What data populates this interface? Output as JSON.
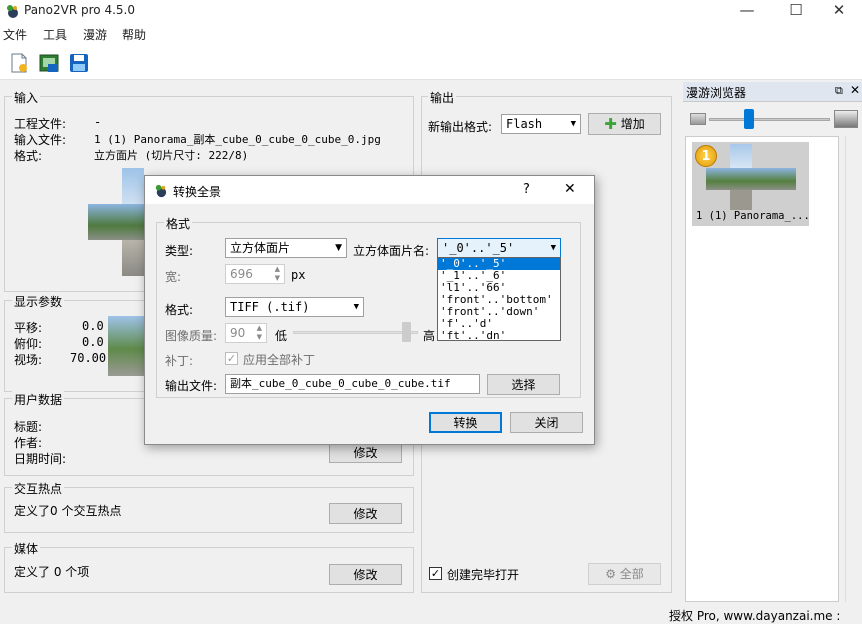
{
  "window": {
    "title": "Pano2VR pro 4.5.0",
    "minimize": "—",
    "maximize": "☐",
    "close": "✕"
  },
  "menu": [
    "文件",
    "工具",
    "漫游",
    "帮助"
  ],
  "input": {
    "title": "输入",
    "project_label": "工程文件:",
    "project_value": "-",
    "input_label": "输入文件:",
    "input_value": "1 (1) Panorama_副本_cube_0_cube_0_cube_0.jpg",
    "format_label": "格式:",
    "format_value": "立方面片 (切片尺寸: 222/8)"
  },
  "display": {
    "title": "显示参数",
    "pan_label": "平移:",
    "pan_value": "0.0",
    "tilt_label": "俯仰:",
    "tilt_value": "0.0",
    "fov_label": "视场:",
    "fov_value": "70.00"
  },
  "user_data": {
    "title": "用户数据",
    "title_label": "标题:",
    "author_label": "作者:",
    "date_label": "日期时间:",
    "edit_label": "修改"
  },
  "hotspots": {
    "title": "交互热点",
    "text": "定义了0 个交互热点",
    "edit_label": "修改"
  },
  "media": {
    "title": "媒体",
    "text": "定义了 0 个项",
    "edit_label": "修改"
  },
  "output": {
    "title": "输出",
    "new_format_label": "新输出格式:",
    "format_value": "Flash",
    "add_label": "增加",
    "open_after_label": "创建完毕打开",
    "all_label": "全部"
  },
  "tour_browser": {
    "title": "漫游浏览器",
    "zoom_fraction": 0.33,
    "thumb_caption": "1 (1) Panorama_...",
    "thumb_badge": "1"
  },
  "dialog": {
    "title": "转换全景",
    "help": "?",
    "close": "✕",
    "group_title": "格式",
    "type_label": "类型:",
    "type_value": "立方体面片",
    "face_name_label": "立方体面片名:",
    "face_name_value": "'_0'..'_5'",
    "width_label": "宽:",
    "width_value": "696",
    "width_unit": "px",
    "format_label": "格式:",
    "format_value": "TIFF (.tif)",
    "quality_label": "图像质量:",
    "quality_value": "90",
    "quality_low": "低",
    "quality_high": "高",
    "quality_fraction": 0.9,
    "patch_label": "补丁:",
    "patch_check_label": "应用全部补丁",
    "output_label": "输出文件:",
    "output_value": "副本_cube_0_cube_0_cube_0_cube.tif",
    "browse_label": "选择",
    "convert_label": "转换",
    "close_label": "关闭",
    "face_name_options": [
      "'_0'..'_5'",
      "'_1'..'_6'",
      "'l1'..'66'",
      "'front'..'bottom'",
      "'front'..'down'",
      "'f'..'d'",
      "'ft'..'dn'"
    ]
  },
  "status": {
    "text": "授权 Pro, www.dayanzai.me :"
  }
}
